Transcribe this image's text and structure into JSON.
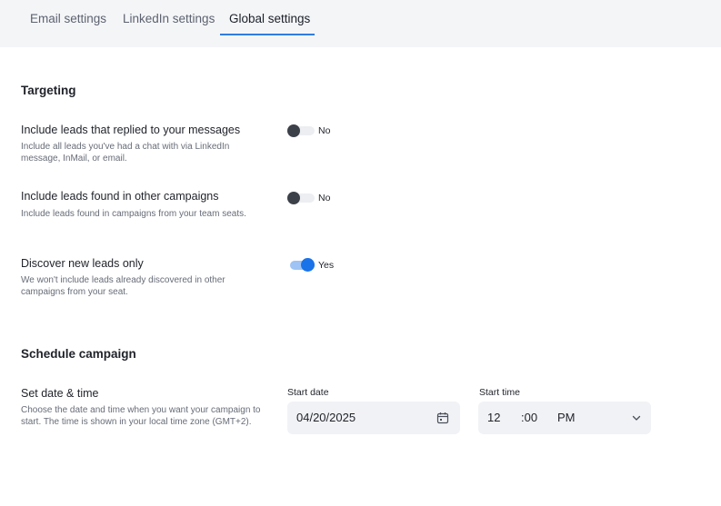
{
  "tabs": [
    {
      "label": "Email settings"
    },
    {
      "label": "LinkedIn settings"
    },
    {
      "label": "Global settings",
      "active": true
    }
  ],
  "targeting": {
    "title": "Targeting",
    "rows": [
      {
        "title": "Include leads that replied to your messages",
        "description": "Include all leads you've had a chat with via LinkedIn message, InMail, or email.",
        "toggle_state": "off",
        "toggle_label": "No"
      },
      {
        "title": "Include leads found in other campaigns",
        "description": "Include leads found in campaigns from your team seats.",
        "toggle_state": "off",
        "toggle_label": "No"
      },
      {
        "title": "Discover new leads only",
        "description": "We won't include leads already discovered in other campaigns from your seat.",
        "toggle_state": "on",
        "toggle_label": "Yes"
      }
    ]
  },
  "schedule": {
    "title": "Schedule campaign",
    "row_title": "Set date & time",
    "row_description": "Choose the date and time when you want your campaign to start. The time is shown in your local time zone (GMT+2).",
    "start_date_label": "Start date",
    "start_date_value": "04/20/2025",
    "start_time_label": "Start time",
    "hour": "12",
    "minute": ":00",
    "meridiem": "PM"
  },
  "icons": {
    "calendar": "calendar-icon",
    "chevron": "chevron-down-icon"
  },
  "colors": {
    "accent": "#1a73e8",
    "tab_underline": "#2f7de1",
    "toggle_off_knob": "#3c4049"
  }
}
